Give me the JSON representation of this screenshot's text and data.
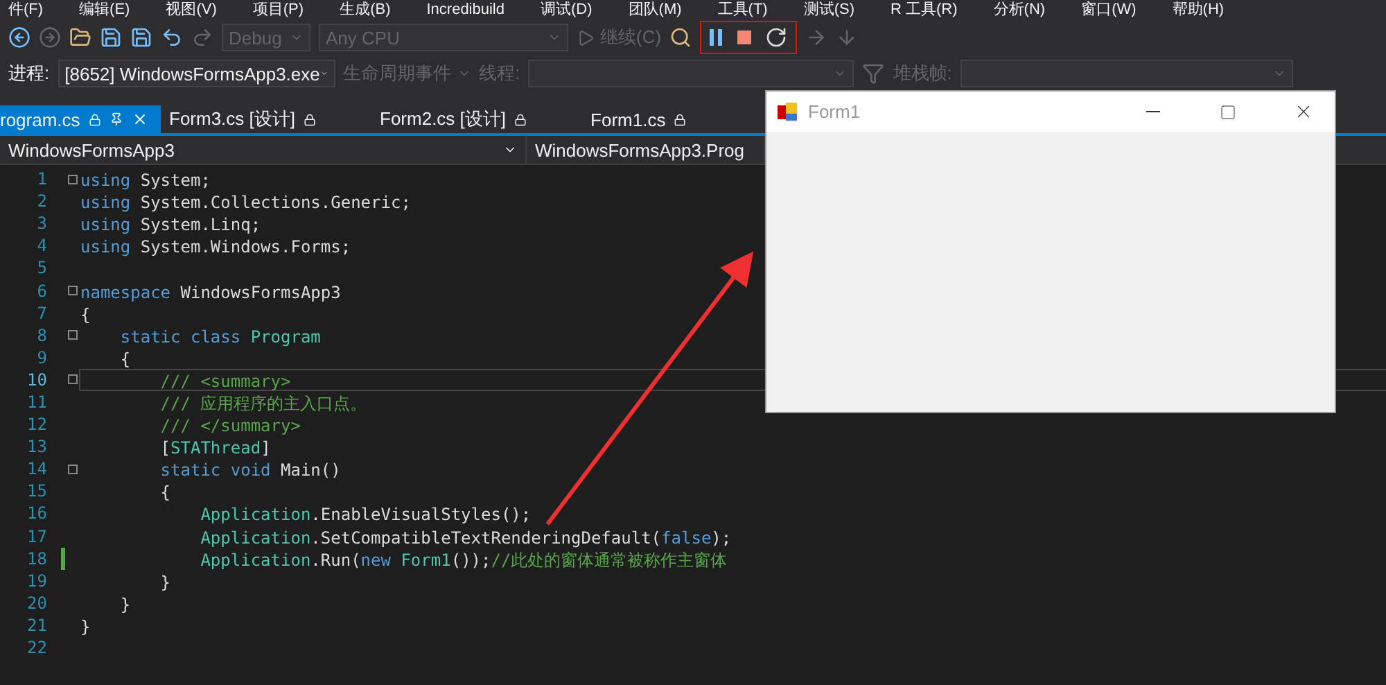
{
  "menu": [
    "件(F)",
    "编辑(E)",
    "视图(V)",
    "项目(P)",
    "生成(B)",
    "Incredibuild",
    "调试(D)",
    "团队(M)",
    "工具(T)",
    "测试(S)",
    "R 工具(R)",
    "分析(N)",
    "窗口(W)",
    "帮助(H)"
  ],
  "toolbar": {
    "configuration": "Debug",
    "platform": "Any CPU",
    "continue": "继续(C)"
  },
  "debug_toolbar": {
    "process_label": "进程:",
    "process": "[8652] WindowsFormsApp3.exe",
    "lifecycle": "生命周期事件",
    "thread_label": "线程:",
    "stack_label": "堆栈帧:"
  },
  "tabs": [
    {
      "label": "rogram.cs",
      "selected": true
    },
    {
      "label": "Form3.cs [设计]",
      "selected": false
    },
    {
      "label": "Form2.cs [设计]",
      "selected": false
    },
    {
      "label": "Form1.cs",
      "selected": false
    }
  ],
  "nav": {
    "project": "WindowsFormsApp3",
    "member": "WindowsFormsApp3.Prog"
  },
  "code": [
    {
      "number": "1",
      "foldable": true,
      "changed": false,
      "current": false,
      "tokens": [
        {
          "kind": "keyword",
          "text": "using"
        },
        {
          "kind": "plain",
          "text": " System;"
        }
      ]
    },
    {
      "number": "2",
      "foldable": false,
      "changed": false,
      "current": false,
      "tokens": [
        {
          "kind": "keyword",
          "text": "using"
        },
        {
          "kind": "plain",
          "text": " System.Collections.Generic;"
        }
      ]
    },
    {
      "number": "3",
      "foldable": false,
      "changed": false,
      "current": false,
      "tokens": [
        {
          "kind": "keyword",
          "text": "using"
        },
        {
          "kind": "plain",
          "text": " System.Linq;"
        }
      ]
    },
    {
      "number": "4",
      "foldable": false,
      "changed": false,
      "current": false,
      "tokens": [
        {
          "kind": "keyword",
          "text": "using"
        },
        {
          "kind": "plain",
          "text": " System.Windows.Forms;"
        }
      ]
    },
    {
      "number": "5",
      "foldable": false,
      "changed": false,
      "current": false
    },
    {
      "number": "6",
      "foldable": true,
      "changed": false,
      "current": false,
      "tokens": [
        {
          "kind": "keyword",
          "text": "namespace"
        },
        {
          "kind": "plain",
          "text": " WindowsFormsApp3"
        }
      ]
    },
    {
      "number": "7",
      "foldable": false,
      "changed": false,
      "current": false,
      "tokens": [
        {
          "kind": "plain",
          "text": "{"
        }
      ]
    },
    {
      "number": "8",
      "foldable": true,
      "changed": false,
      "current": false,
      "tokens": [
        {
          "kind": "keyword",
          "text": "    static class"
        },
        {
          "kind": "type",
          "text": " Program"
        }
      ]
    },
    {
      "number": "9",
      "foldable": false,
      "changed": false,
      "current": false,
      "tokens": [
        {
          "kind": "plain",
          "text": "    {"
        }
      ]
    },
    {
      "number": "10",
      "foldable": true,
      "changed": false,
      "current": true,
      "tokens": [
        {
          "kind": "comment",
          "text": "        /// <summary>"
        }
      ]
    },
    {
      "number": "11",
      "foldable": false,
      "changed": false,
      "current": false,
      "tokens": [
        {
          "kind": "comment",
          "text": "        /// 应用程序的主入口点。"
        }
      ]
    },
    {
      "number": "12",
      "foldable": false,
      "changed": false,
      "current": false,
      "tokens": [
        {
          "kind": "comment",
          "text": "        /// </summary>"
        }
      ]
    },
    {
      "number": "13",
      "foldable": false,
      "changed": false,
      "current": false,
      "tokens": [
        {
          "kind": "plain",
          "text": "        ["
        },
        {
          "kind": "type",
          "text": "STAThread"
        },
        {
          "kind": "plain",
          "text": "]"
        }
      ]
    },
    {
      "number": "14",
      "foldable": true,
      "changed": false,
      "current": false,
      "tokens": [
        {
          "kind": "keyword",
          "text": "        static void"
        },
        {
          "kind": "plain",
          "text": " Main()"
        }
      ]
    },
    {
      "number": "15",
      "foldable": false,
      "changed": false,
      "current": false,
      "tokens": [
        {
          "kind": "plain",
          "text": "        {"
        }
      ]
    },
    {
      "number": "16",
      "foldable": false,
      "changed": false,
      "current": false,
      "tokens": [
        {
          "kind": "type",
          "text": "            Application"
        },
        {
          "kind": "plain",
          "text": ".EnableVisualStyles();"
        }
      ]
    },
    {
      "number": "17",
      "foldable": false,
      "changed": false,
      "current": false,
      "tokens": [
        {
          "kind": "type",
          "text": "            Application"
        },
        {
          "kind": "plain",
          "text": ".SetCompatibleTextRenderingDefault("
        },
        {
          "kind": "keyword",
          "text": "false"
        },
        {
          "kind": "plain",
          "text": ");"
        }
      ]
    },
    {
      "number": "18",
      "foldable": false,
      "changed": true,
      "current": false,
      "tokens": [
        {
          "kind": "type",
          "text": "            Application"
        },
        {
          "kind": "plain",
          "text": ".Run("
        },
        {
          "kind": "keyword",
          "text": "new"
        },
        {
          "kind": "type",
          "text": " Form1"
        },
        {
          "kind": "plain",
          "text": "());"
        },
        {
          "kind": "comment",
          "text": "//此处的窗体通常被称作主窗体"
        }
      ]
    },
    {
      "number": "19",
      "foldable": false,
      "changed": false,
      "current": false,
      "tokens": [
        {
          "kind": "plain",
          "text": "        }"
        }
      ]
    },
    {
      "number": "20",
      "foldable": false,
      "changed": false,
      "current": false,
      "tokens": [
        {
          "kind": "plain",
          "text": "    }"
        }
      ]
    },
    {
      "number": "21",
      "foldable": false,
      "changed": false,
      "current": false,
      "tokens": [
        {
          "kind": "plain",
          "text": "}"
        }
      ]
    },
    {
      "number": "22",
      "foldable": false,
      "changed": false,
      "current": false
    }
  ],
  "form_window": {
    "title": "Form1"
  }
}
